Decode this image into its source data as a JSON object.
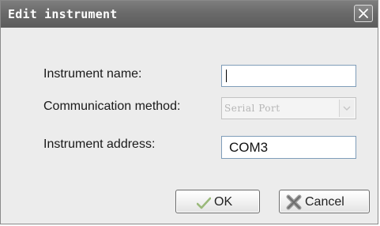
{
  "dialog": {
    "title": "Edit instrument",
    "close_icon": "close-icon"
  },
  "form": {
    "instrument_name": {
      "label": "Instrument name:",
      "value": ""
    },
    "communication_method": {
      "label": "Communication method:",
      "value": "Serial Port",
      "disabled": true
    },
    "instrument_address": {
      "label": "Instrument address:",
      "value": "COM3"
    }
  },
  "buttons": {
    "ok": {
      "label": "OK",
      "icon": "checkmark-icon"
    },
    "cancel": {
      "label": "Cancel",
      "icon": "cancel-x-icon"
    }
  },
  "colors": {
    "titlebar": "#6a6a6a",
    "background": "#ececec",
    "check_green": "#8fbf3a"
  }
}
